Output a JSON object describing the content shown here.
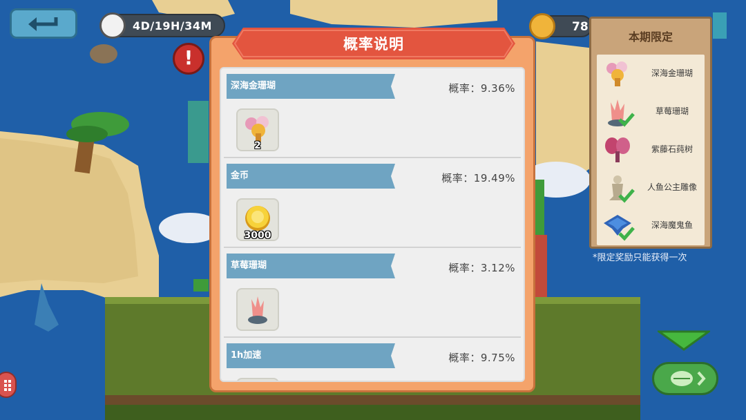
{
  "hud": {
    "back_icon": "back-arrow-icon",
    "timer_text": "4D/19H/34M",
    "coin_count": "78"
  },
  "dialog": {
    "title": "概率说明",
    "rows": [
      {
        "name": "深海金珊瑚",
        "probability": "概率：9.36%",
        "qty": "2",
        "icon": "gold-coral-icon"
      },
      {
        "name": "金币",
        "probability": "概率：19.49%",
        "qty": "3000",
        "icon": "gold-coin-icon"
      },
      {
        "name": "草莓珊瑚",
        "probability": "概率：3.12%",
        "qty": "",
        "icon": "strawberry-coral-icon"
      },
      {
        "name": "1h加速",
        "probability": "概率：9.75%",
        "qty": "",
        "icon": "speedup-icon"
      }
    ]
  },
  "limited": {
    "title": "本期限定",
    "items": [
      {
        "name": "深海金珊瑚",
        "icon": "gold-coral-icon",
        "collected": false
      },
      {
        "name": "草莓珊瑚",
        "icon": "strawberry-coral-icon",
        "collected": true
      },
      {
        "name": "紫藤石莼树",
        "icon": "purple-tree-icon",
        "collected": false
      },
      {
        "name": "人鱼公主雕像",
        "icon": "mermaid-statue-icon",
        "collected": true
      },
      {
        "name": "深海魔鬼鱼",
        "icon": "devil-fish-icon",
        "collected": true
      }
    ],
    "note": "*限定奖励只能获得一次"
  },
  "colors": {
    "ribbon": "#e3553f",
    "row_banner": "#6fa4c2",
    "panel": "#c9a47a",
    "check": "#3fb24a"
  }
}
